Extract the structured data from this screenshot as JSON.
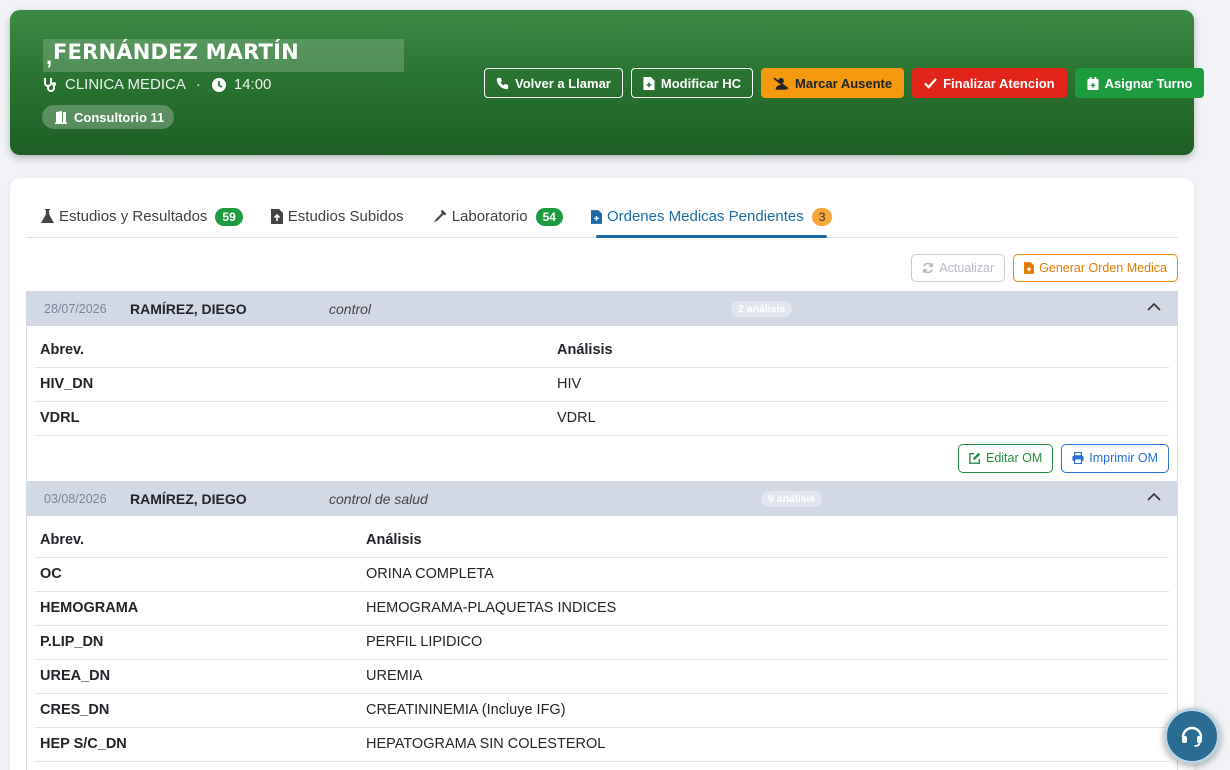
{
  "header": {
    "name_prefix": ",",
    "patient_name": "FERNÁNDEZ MARTÍN",
    "specialty": "CLINICA MEDICA",
    "separator": "·",
    "time": "14:00",
    "room": "Consultorio 11",
    "actions": {
      "recall": "Volver a Llamar",
      "edit_hc": "Modificar HC",
      "absent": "Marcar Ausente",
      "finish": "Finalizar Atencion",
      "assign": "Asignar Turno"
    }
  },
  "tabs": [
    {
      "label": "Estudios y Resultados",
      "badge": "59"
    },
    {
      "label": "Estudios Subidos",
      "badge": ""
    },
    {
      "label": "Laboratorio",
      "badge": "54"
    },
    {
      "label": "Ordenes Medicas Pendientes",
      "badge": "3"
    }
  ],
  "toolbar": {
    "refresh": "Actualizar",
    "generate": "Generar Orden Medica"
  },
  "orders": [
    {
      "date": "28/07/2026",
      "doctor": "RAMÍREZ, DIEGO",
      "description": "control",
      "count": "2 análisis",
      "col_abbr": "Abrev.",
      "col_analysis": "Análisis",
      "rows": [
        {
          "abbr": "HIV_DN",
          "analysis": "HIV"
        },
        {
          "abbr": "VDRL",
          "analysis": "VDRL"
        }
      ],
      "edit": "Editar OM",
      "print": "Imprimir OM"
    },
    {
      "date": "03/08/2026",
      "doctor": "RAMÍREZ, DIEGO",
      "description": "control de salud",
      "count": "9 análisis",
      "col_abbr": "Abrev.",
      "col_analysis": "Análisis",
      "rows": [
        {
          "abbr": "OC",
          "analysis": "ORINA COMPLETA"
        },
        {
          "abbr": "HEMOGRAMA",
          "analysis": "HEMOGRAMA-PLAQUETAS INDICES"
        },
        {
          "abbr": "P.LIP_DN",
          "analysis": "PERFIL LIPIDICO"
        },
        {
          "abbr": "UREA_DN",
          "analysis": "UREMIA"
        },
        {
          "abbr": "CRES_DN",
          "analysis": "CREATININEMIA (Incluye IFG)"
        },
        {
          "abbr": "HEP S/C_DN",
          "analysis": "HEPATOGRAMA SIN COLESTEROL"
        }
      ]
    }
  ],
  "colors": {
    "header_green": "#2a7432",
    "active_tab": "#1c6ba8",
    "warning": "#f59a0e",
    "danger": "#e3241b",
    "success": "#1e9a3f"
  }
}
